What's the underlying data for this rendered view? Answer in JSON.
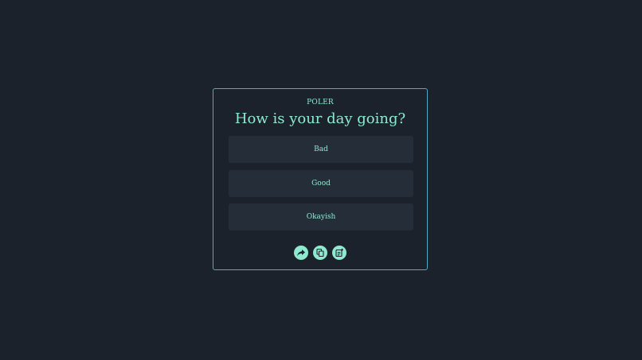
{
  "poll": {
    "brand": "POLER",
    "question": "How is your day going?",
    "options": [
      {
        "label": "Bad"
      },
      {
        "label": "Good"
      },
      {
        "label": "Okayish"
      }
    ]
  },
  "actions": [
    {
      "icon": "share-icon"
    },
    {
      "icon": "copy-icon"
    },
    {
      "icon": "new-poll-icon"
    }
  ],
  "colors": {
    "background": "#1b222c",
    "card_border": "#4fa9c9",
    "accent": "#8fe9cf",
    "option_bg": "#252d39",
    "icon_glyph": "#1b222c"
  }
}
